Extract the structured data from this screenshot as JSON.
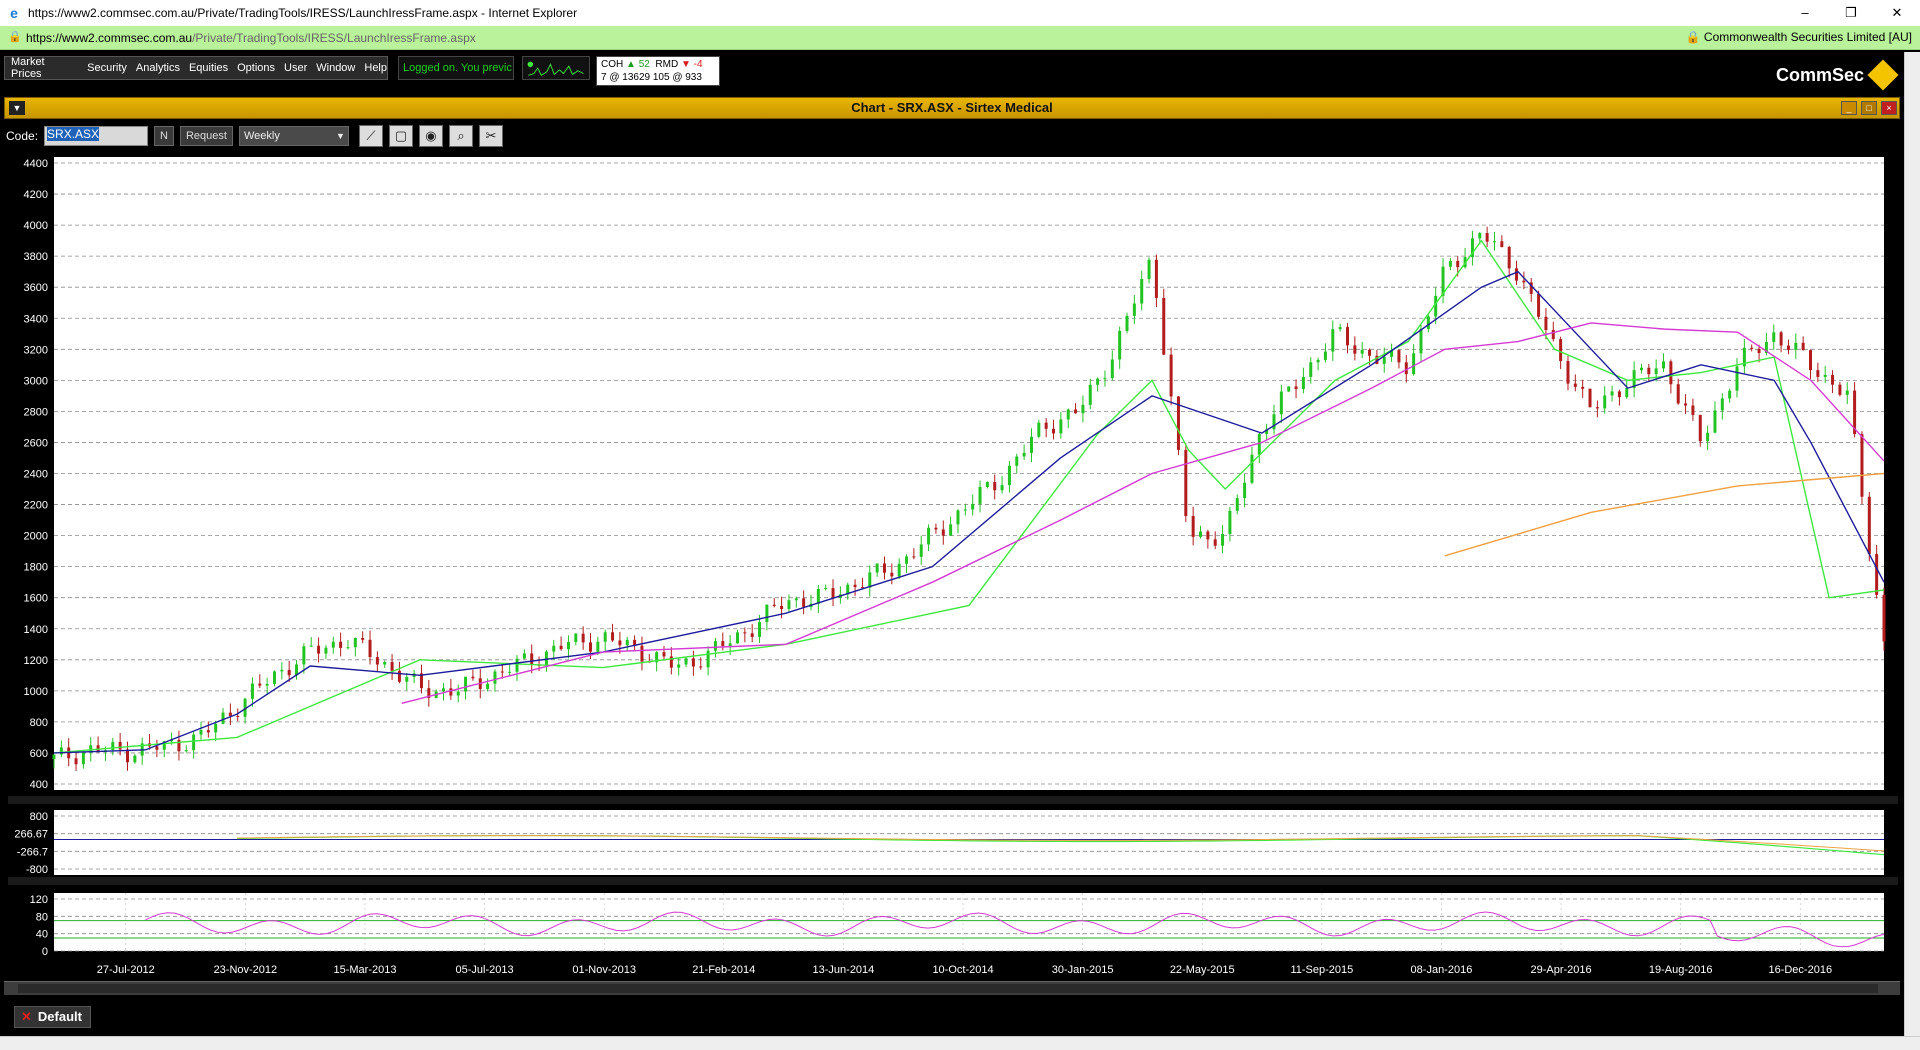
{
  "window": {
    "title": "https://www2.commsec.com.au/Private/TradingTools/IRESS/LaunchIressFrame.aspx - Internet Explorer",
    "minimize": "–",
    "restore": "❐",
    "close": "✕"
  },
  "address_bar": {
    "url_prefix": "https://www2.commsec.com.au",
    "url_suffix": "/Private/TradingTools/IRESS/LaunchIressFrame.aspx",
    "secure_site": "Commonwealth Securities Limited [AU]"
  },
  "menu": {
    "items": [
      "Market Prices",
      "Security",
      "Analytics",
      "Equities",
      "Options",
      "User",
      "Window",
      "Help"
    ],
    "status": "Logged on. You previc",
    "ticker_line1": {
      "code1": "COH",
      "arrow1": "▲",
      "chg1": "52",
      "code2": "RMD",
      "arrow2": "▼",
      "chg2": "-4"
    },
    "ticker_line2": "7 @ 13629  105 @ 933",
    "brand": "CommSec"
  },
  "chart_window": {
    "title": "Chart - SRX.ASX - Sirtex Medical",
    "code_label": "Code:",
    "code_value": "SRX.ASX",
    "n_button": "N",
    "request_button": "Request",
    "period": "Weekly"
  },
  "bottom": {
    "default_label": "Default"
  },
  "colors": {
    "candle_up": "#22c422",
    "candle_down": "#b21c1c",
    "ma_fast": "#3ee83e",
    "ma_mid": "#1c1c9c",
    "ma_slow": "#d43ad4",
    "ma_long": "#f0a040"
  },
  "chart_data": {
    "type": "line",
    "price_panel": {
      "y_ticks": [
        400,
        600,
        800,
        1000,
        1200,
        1400,
        1600,
        1800,
        2000,
        2200,
        2400,
        2600,
        2800,
        3000,
        3200,
        3400,
        3600,
        3800,
        4000,
        4200,
        4400
      ],
      "ylim": [
        400,
        4400
      ],
      "grid": true
    },
    "x_ticks": [
      "27-Jul-2012",
      "23-Nov-2012",
      "15-Mar-2013",
      "05-Jul-2013",
      "01-Nov-2013",
      "21-Feb-2014",
      "13-Jun-2014",
      "10-Oct-2014",
      "30-Jan-2015",
      "22-May-2015",
      "11-Sep-2015",
      "08-Jan-2016",
      "29-Apr-2016",
      "19-Aug-2016",
      "16-Dec-2016"
    ],
    "series": [
      {
        "name": "close",
        "t": [
          0.0,
          0.02,
          0.04,
          0.06,
          0.08,
          0.1,
          0.12,
          0.14,
          0.16,
          0.18,
          0.2,
          0.22,
          0.24,
          0.26,
          0.28,
          0.3,
          0.32,
          0.34,
          0.36,
          0.38,
          0.4,
          0.42,
          0.44,
          0.46,
          0.48,
          0.5,
          0.52,
          0.54,
          0.56,
          0.58,
          0.6,
          0.62,
          0.64,
          0.66,
          0.68,
          0.7,
          0.72,
          0.74,
          0.76,
          0.78,
          0.8,
          0.82,
          0.84,
          0.86,
          0.88,
          0.9,
          0.92,
          0.94,
          0.96,
          0.98,
          1.0
        ],
        "values": [
          560,
          620,
          610,
          640,
          700,
          900,
          1100,
          1250,
          1330,
          1180,
          1010,
          1000,
          1100,
          1200,
          1300,
          1340,
          1260,
          1150,
          1250,
          1400,
          1580,
          1600,
          1700,
          1800,
          2000,
          2200,
          2400,
          2700,
          2800,
          3200,
          3800,
          2000,
          2000,
          2700,
          3000,
          3300,
          3150,
          3100,
          3700,
          3950,
          3700,
          3200,
          2800,
          3000,
          3100,
          2600,
          3100,
          3300,
          3100,
          2900,
          1300
        ]
      },
      {
        "name": "ma-fast",
        "t": [
          0.0,
          0.1,
          0.2,
          0.3,
          0.4,
          0.5,
          0.57,
          0.6,
          0.62,
          0.64,
          0.7,
          0.74,
          0.78,
          0.82,
          0.86,
          0.9,
          0.94,
          0.97,
          1.0
        ],
        "values": [
          600,
          700,
          1200,
          1150,
          1300,
          1550,
          2650,
          3000,
          2550,
          2300,
          3000,
          3250,
          3900,
          3200,
          3000,
          3050,
          3150,
          1600,
          1650
        ]
      },
      {
        "name": "ma-mid",
        "t": [
          0.0,
          0.05,
          0.1,
          0.14,
          0.2,
          0.3,
          0.4,
          0.48,
          0.55,
          0.6,
          0.66,
          0.72,
          0.78,
          0.8,
          0.84,
          0.86,
          0.9,
          0.94,
          0.96,
          1.0
        ],
        "values": [
          600,
          620,
          850,
          1160,
          1100,
          1250,
          1500,
          1800,
          2500,
          2900,
          2660,
          3100,
          3600,
          3700,
          3200,
          2950,
          3100,
          3000,
          2600,
          1700
        ]
      },
      {
        "name": "ma-slow",
        "t": [
          0.19,
          0.3,
          0.4,
          0.48,
          0.55,
          0.6,
          0.66,
          0.72,
          0.76,
          0.8,
          0.84,
          0.88,
          0.92,
          0.96,
          1.0
        ],
        "values": [
          920,
          1250,
          1300,
          1700,
          2100,
          2400,
          2600,
          2950,
          3200,
          3250,
          3370,
          3330,
          3310,
          3000,
          2480
        ]
      },
      {
        "name": "ma-long",
        "t": [
          0.76,
          0.84,
          0.92,
          1.0
        ],
        "values": [
          1870,
          2150,
          2320,
          2400
        ]
      }
    ],
    "macd_panel": {
      "y_ticks": [
        800,
        266.67,
        -266.7,
        -800
      ],
      "ylim": [
        -800,
        800
      ]
    },
    "rsi_panel": {
      "y_ticks": [
        0,
        40,
        80,
        120
      ],
      "ylim": [
        0,
        120
      ],
      "levels": [
        30,
        70
      ]
    }
  }
}
